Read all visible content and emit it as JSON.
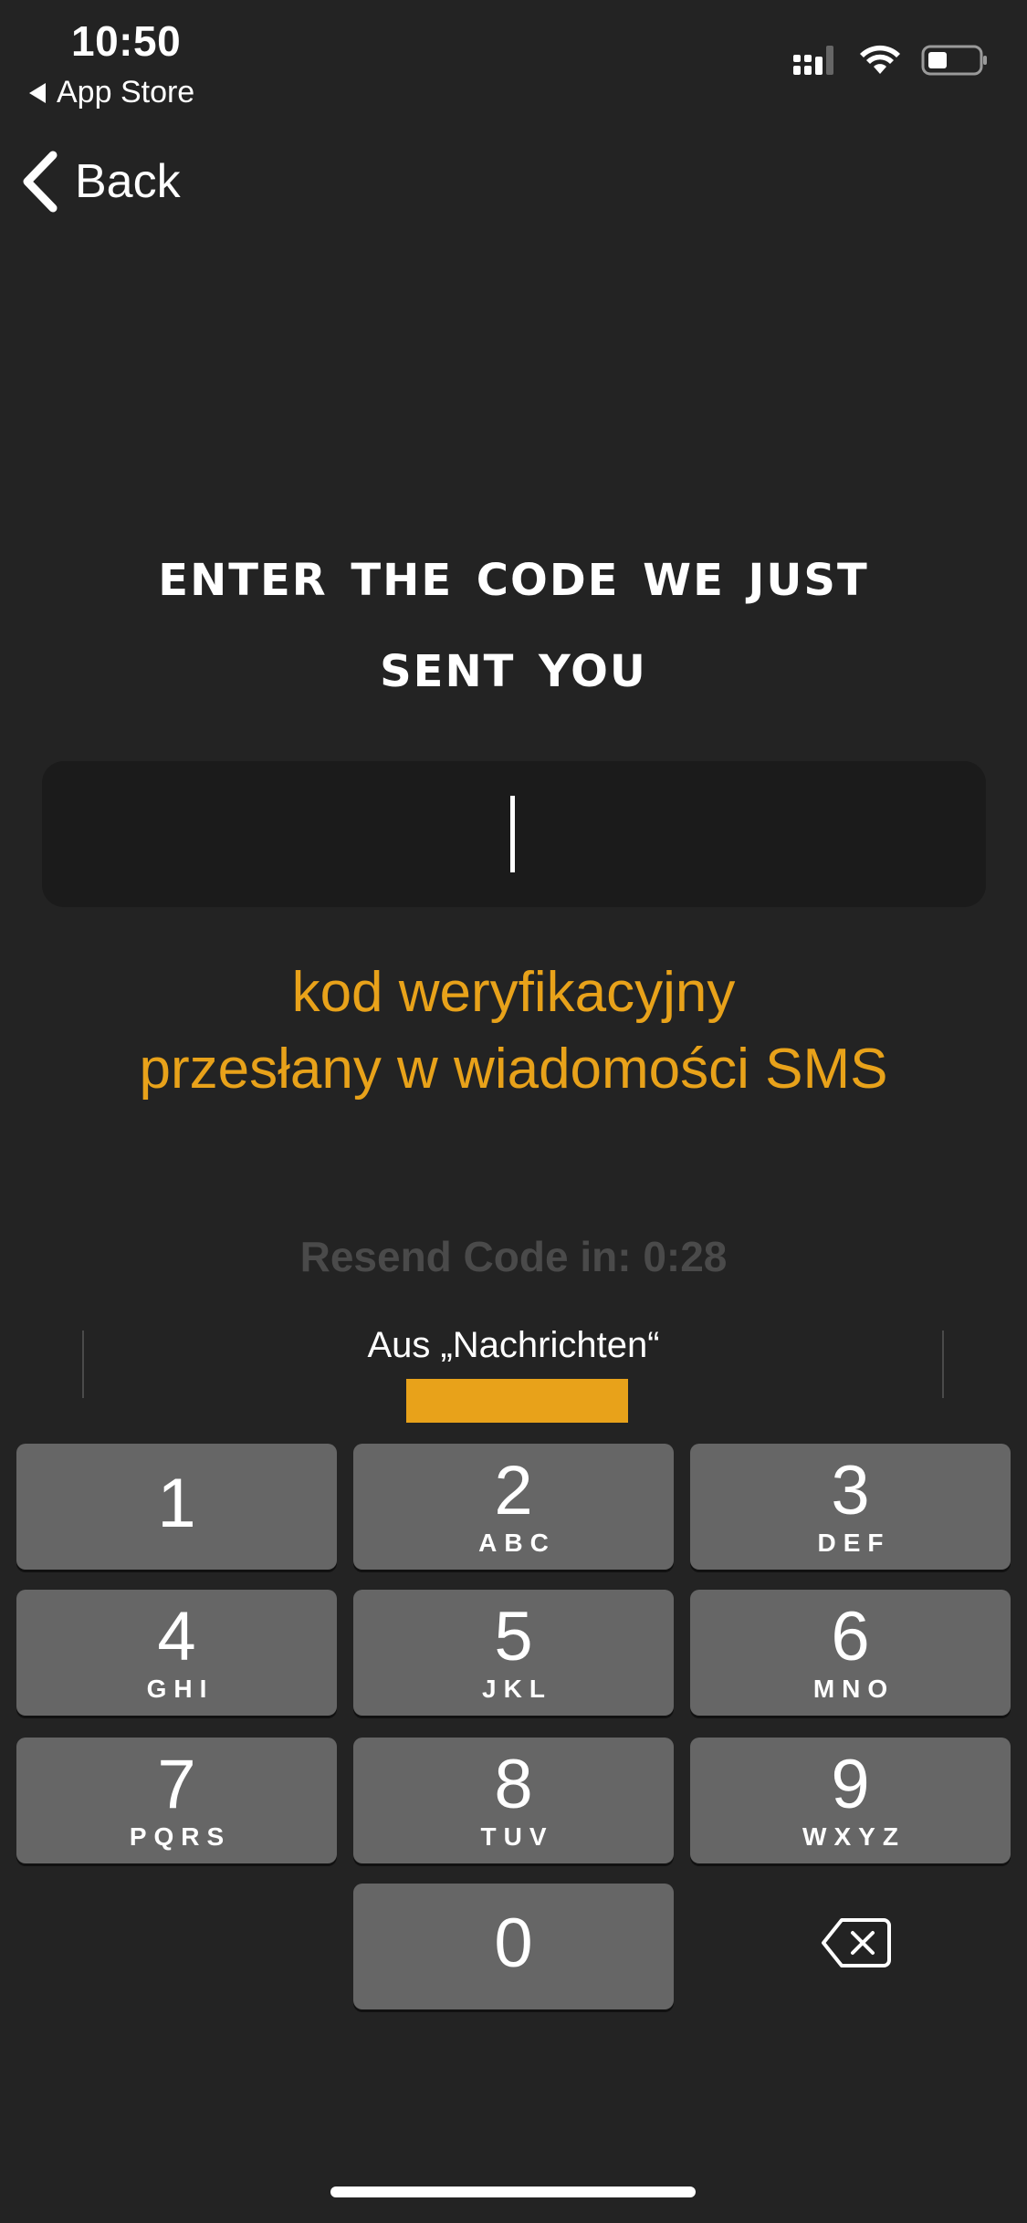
{
  "status_bar": {
    "time": "10:50",
    "back_app_label": "App Store",
    "icons": [
      "cellular-icon",
      "wifi-icon",
      "battery-icon"
    ]
  },
  "nav": {
    "back_label": "Back"
  },
  "heading": {
    "line1": "Enter the code we just",
    "line2": "sent you"
  },
  "code_input": {
    "value": "",
    "placeholder": ""
  },
  "hint": {
    "line1": "kod weryfikacyjny",
    "line2": "przesłany w wiadomości SMS"
  },
  "resend_text": "Resend Code in: 0:28",
  "keyboard": {
    "suggestion_label": "Aus „Nachrichten“",
    "accent_color": "#e8a21a",
    "keys": [
      {
        "num": "1",
        "letters": ""
      },
      {
        "num": "2",
        "letters": "ABC"
      },
      {
        "num": "3",
        "letters": "DEF"
      },
      {
        "num": "4",
        "letters": "GHI"
      },
      {
        "num": "5",
        "letters": "JKL"
      },
      {
        "num": "6",
        "letters": "MNO"
      },
      {
        "num": "7",
        "letters": "PQRS"
      },
      {
        "num": "8",
        "letters": "TUV"
      },
      {
        "num": "9",
        "letters": "WXYZ"
      },
      {
        "num": "0",
        "letters": ""
      }
    ],
    "delete_icon": "delete-backspace-icon"
  }
}
